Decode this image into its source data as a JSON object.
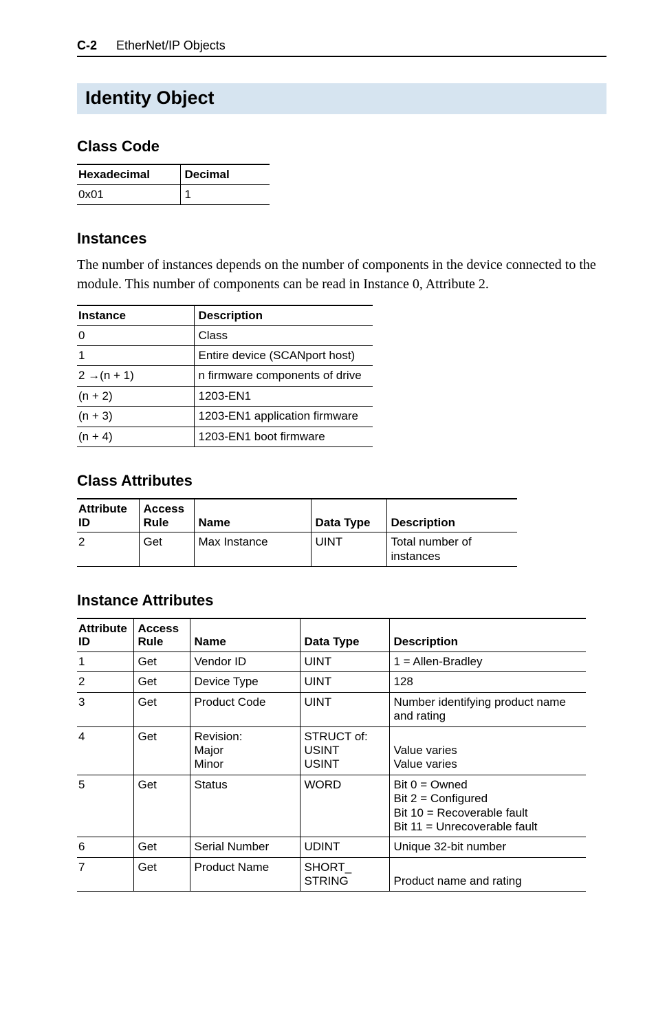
{
  "header": {
    "page_number": "C-2",
    "chapter_title": "EtherNet/IP Objects"
  },
  "title": "Identity Object",
  "sections": {
    "class_code": {
      "heading": "Class Code",
      "headers": [
        "Hexadecimal",
        "Decimal"
      ],
      "rows": [
        [
          "0x01",
          "1"
        ]
      ]
    },
    "instances": {
      "heading": "Instances",
      "body": "The number of instances depends on the number of components in the device connected to the module. This number of components can be read in Instance 0, Attribute 2.",
      "headers": [
        "Instance",
        "Description"
      ],
      "rows": [
        [
          "0",
          "Class"
        ],
        [
          "1",
          "Entire device (SCANport host)"
        ],
        [
          "2 →(n + 1)",
          "n firmware components of drive"
        ],
        [
          "(n + 2)",
          "1203-EN1"
        ],
        [
          "(n + 3)",
          "1203-EN1 application firmware"
        ],
        [
          "(n + 4)",
          "1203-EN1 boot firmware"
        ]
      ]
    },
    "class_attributes": {
      "heading": "Class Attributes",
      "headers": [
        "Attribute ID",
        "Access Rule",
        "Name",
        "Data Type",
        "Description"
      ],
      "rows": [
        [
          "2",
          "Get",
          "Max Instance",
          "UINT",
          "Total number of instances"
        ]
      ]
    },
    "instance_attributes": {
      "heading": "Instance Attributes",
      "headers": [
        "Attribute ID",
        "Access Rule",
        "Name",
        "Data Type",
        "Description"
      ],
      "rows": [
        [
          "1",
          "Get",
          "Vendor ID",
          "UINT",
          "1 = Allen-Bradley"
        ],
        [
          "2",
          "Get",
          "Device Type",
          "UINT",
          "128"
        ],
        [
          "3",
          "Get",
          "Product Code",
          "UINT",
          "Number identifying product name and rating"
        ],
        [
          "4",
          "Get",
          "Revision:\nMajor\nMinor",
          "STRUCT of:\nUSINT\nUSINT",
          "\nValue varies\nValue varies"
        ],
        [
          "5",
          "Get",
          "Status",
          "WORD",
          "Bit 0 = Owned\nBit 2 = Configured\nBit 10 = Recoverable fault\nBit 11 = Unrecoverable fault"
        ],
        [
          "6",
          "Get",
          "Serial Number",
          "UDINT",
          "Unique 32-bit number"
        ],
        [
          "7",
          "Get",
          "Product Name",
          "SHORT_\nSTRING",
          "\nProduct name and rating"
        ]
      ]
    }
  }
}
